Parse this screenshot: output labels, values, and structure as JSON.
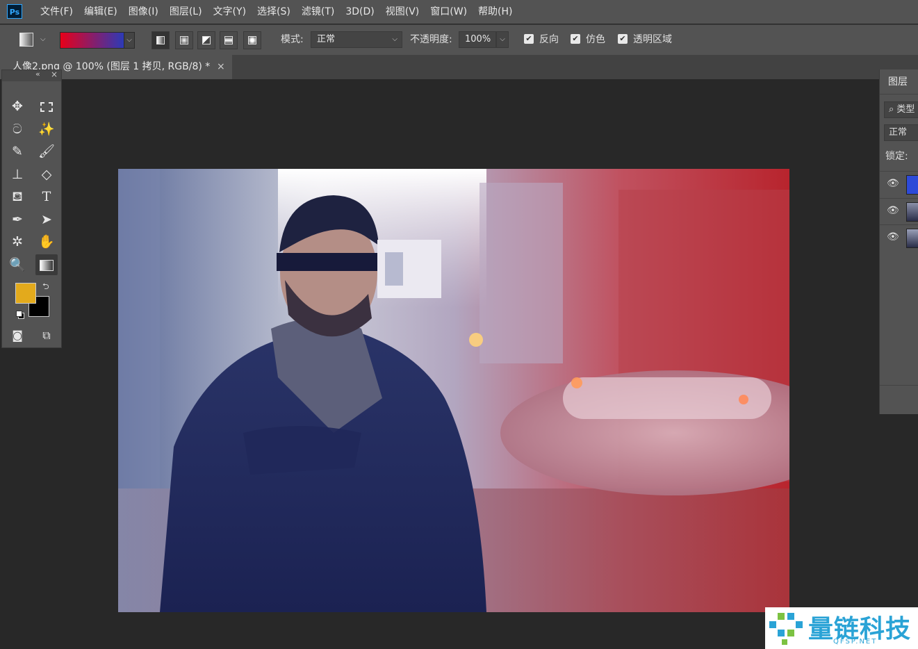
{
  "app": {
    "logo_text": "Ps"
  },
  "menu": [
    "文件(F)",
    "编辑(E)",
    "图像(I)",
    "图层(L)",
    "文字(Y)",
    "选择(S)",
    "滤镜(T)",
    "3D(D)",
    "视图(V)",
    "窗口(W)",
    "帮助(H)"
  ],
  "options": {
    "gradient_preset_colors": [
      "#e8001a",
      "#2b3bb8"
    ],
    "mode_label": "模式:",
    "mode_value": "正常",
    "opacity_label": "不透明度:",
    "opacity_value": "100%",
    "reverse_label": "反向",
    "dither_label": "仿色",
    "transparency_label": "透明区域",
    "reverse_checked": true,
    "dither_checked": true,
    "transparency_checked": true
  },
  "document": {
    "tab_title": "人像2.png @ 100% (图层 1 拷贝, RGB/8) *",
    "close_glyph": "×"
  },
  "toolbar": {
    "collapse_glyph": "«",
    "close_glyph": "×",
    "foreground_color": "#e3aa1c",
    "background_color": "#000000"
  },
  "layers_panel": {
    "tab_label": "图层",
    "filter_label": "类型",
    "blend_mode": "正常",
    "lock_label": "锁定:"
  },
  "watermark": {
    "text": "量链科技",
    "sub": "QFSP.NET"
  }
}
